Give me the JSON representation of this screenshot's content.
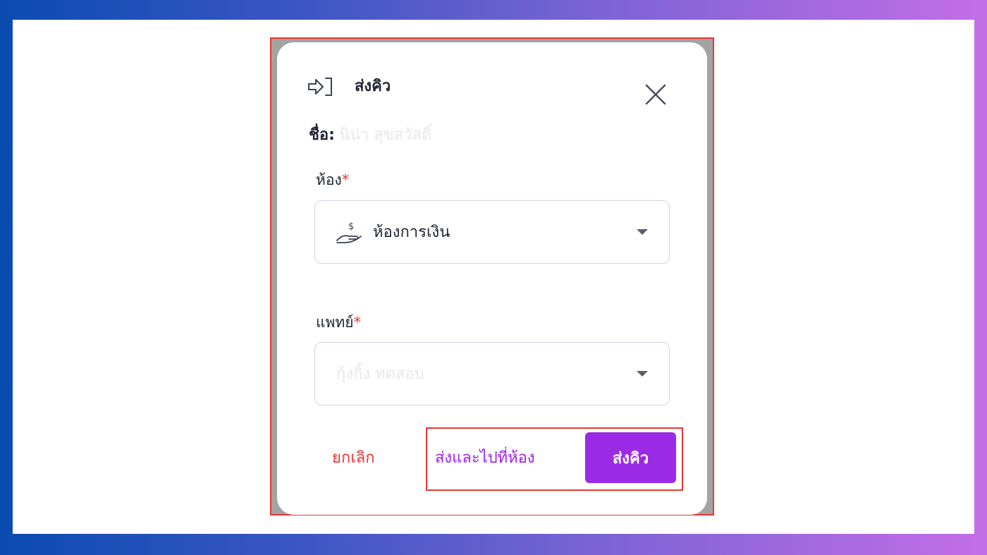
{
  "modal": {
    "title": "ส่งคิว",
    "title_icon": "login-arrow-icon",
    "close_icon": "close-icon"
  },
  "patient": {
    "label": "ชื่อ:",
    "value": "นิน่า สุขสวัสดิ์"
  },
  "room": {
    "label": "ห้อง",
    "required_mark": "*",
    "selected": "ห้องการเงิน",
    "icon": "hand-money-icon"
  },
  "doctor": {
    "label": "แพทย์",
    "required_mark": "*",
    "selected": "กุ้งกิ้ง ทดสอบ"
  },
  "actions": {
    "cancel": "ยกเลิก",
    "send_and_go": "ส่งและไปที่ห้อง",
    "send": "ส่งคิว"
  },
  "colors": {
    "accent": "#9b2ae6",
    "danger": "#e53935",
    "link_purple": "#a020f0"
  }
}
